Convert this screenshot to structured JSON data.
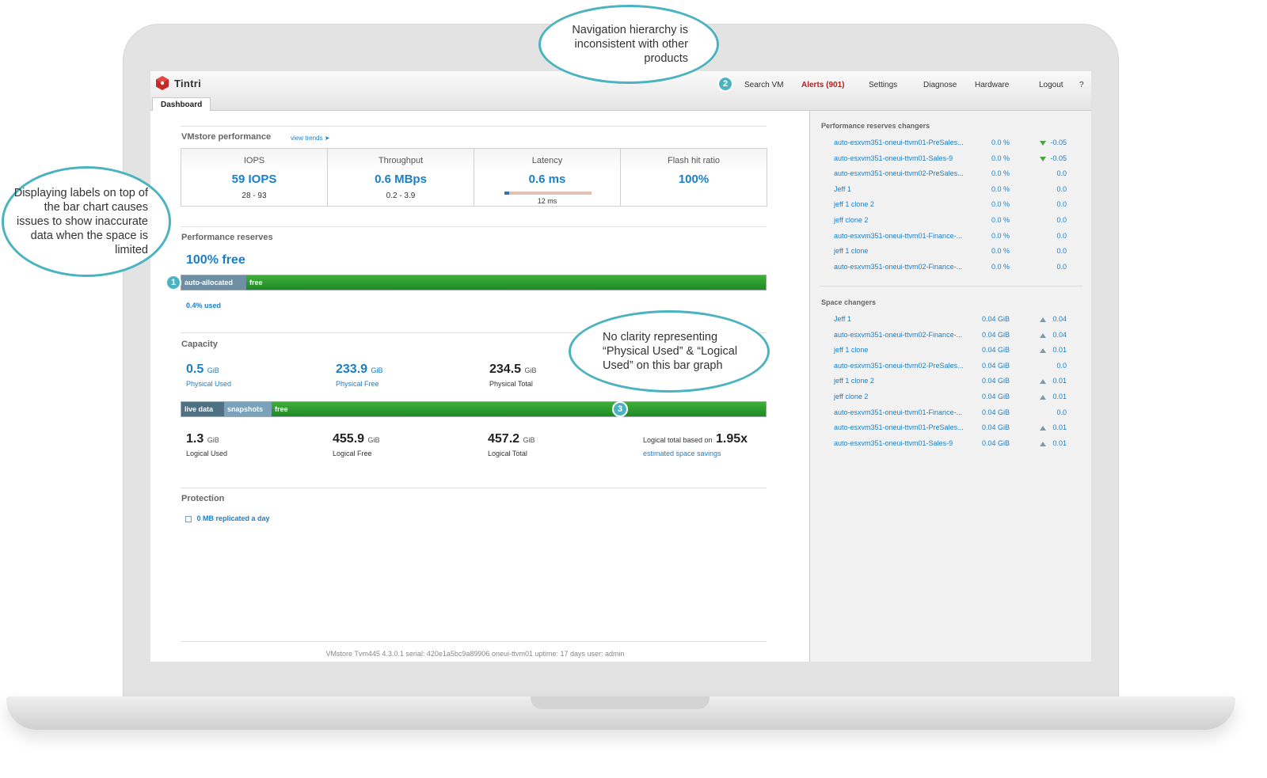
{
  "app": {
    "brand": "Tintri",
    "tab": "Dashboard"
  },
  "nav": {
    "search": "Search VM",
    "alerts": "Alerts (901)",
    "settings": "Settings",
    "diagnose": "Diagnose",
    "hardware": "Hardware",
    "logout": "Logout",
    "help": "?"
  },
  "performance": {
    "title": "VMstore performance",
    "trends_link": "view trends",
    "metrics": [
      {
        "label": "IOPS",
        "value": "59 IOPS",
        "range": "28 - 93"
      },
      {
        "label": "Throughput",
        "value": "0.6 MBps",
        "range": "0.2 - 3.9"
      },
      {
        "label": "Latency",
        "value": "0.6 ms",
        "range": "12 ms"
      },
      {
        "label": "Flash hit ratio",
        "value": "100%",
        "range": ""
      }
    ]
  },
  "reserves": {
    "title": "Performance reserves",
    "free_text": "100% free",
    "seg_auto": "auto-allocated",
    "seg_free": "free",
    "used_text": "0.4% used"
  },
  "capacity": {
    "title": "Capacity",
    "physical_used": {
      "value": "0.5",
      "unit": "GiB",
      "label": "Physical Used"
    },
    "physical_free": {
      "value": "233.9",
      "unit": "GiB",
      "label": "Physical Free"
    },
    "physical_total": {
      "value": "234.5",
      "unit": "GiB",
      "label": "Physical Total"
    },
    "seg_live": "live data",
    "seg_snap": "snapshots",
    "seg_free": "free",
    "logical_used": {
      "value": "1.3",
      "unit": "GiB",
      "label": "Logical Used"
    },
    "logical_free": {
      "value": "455.9",
      "unit": "GiB",
      "label": "Logical Free"
    },
    "logical_total": {
      "value": "457.2",
      "unit": "GiB",
      "label": "Logical Total"
    },
    "savings_prefix": "Logical total based on",
    "savings_value": "1.95x",
    "savings_link": "estimated space savings"
  },
  "protection": {
    "title": "Protection",
    "replicated": "0 MB replicated a day"
  },
  "footer": "VMstore Tvm445 4.3.0.1   serial: 420e1a5bc9a89906   oneui-ttvm01 uptime: 17 days   user: admin",
  "sidebar": {
    "reserves_title": "Performance reserves changers",
    "reserves_rows": [
      {
        "name": "auto-esxvm351-oneui-ttvm01-PreSales...",
        "pct": "0.0 %",
        "delta": "-0.05",
        "dir": "down"
      },
      {
        "name": "auto-esxvm351-oneui-ttvm01-Sales-9",
        "pct": "0.0 %",
        "delta": "-0.05",
        "dir": "down"
      },
      {
        "name": "auto-esxvm351-oneui-ttvm02-PreSales...",
        "pct": "0.0 %",
        "delta": "0.0",
        "dir": "none"
      },
      {
        "name": "Jeff 1",
        "pct": "0.0 %",
        "delta": "0.0",
        "dir": "none"
      },
      {
        "name": "jeff 1 clone 2",
        "pct": "0.0 %",
        "delta": "0.0",
        "dir": "none"
      },
      {
        "name": "jeff clone 2",
        "pct": "0.0 %",
        "delta": "0.0",
        "dir": "none"
      },
      {
        "name": "auto-esxvm351-oneui-ttvm01-Finance-...",
        "pct": "0.0 %",
        "delta": "0.0",
        "dir": "none"
      },
      {
        "name": "jeff 1 clone",
        "pct": "0.0 %",
        "delta": "0.0",
        "dir": "none"
      },
      {
        "name": "auto-esxvm351-oneui-ttvm02-Finance-...",
        "pct": "0.0 %",
        "delta": "0.0",
        "dir": "none"
      }
    ],
    "space_title": "Space changers",
    "space_rows": [
      {
        "name": "Jeff 1",
        "size": "0.04 GiB",
        "delta": "0.04",
        "dir": "up"
      },
      {
        "name": "auto-esxvm351-oneui-ttvm02-Finance-...",
        "size": "0.04 GiB",
        "delta": "0.04",
        "dir": "up"
      },
      {
        "name": "jeff 1 clone",
        "size": "0.04 GiB",
        "delta": "0.01",
        "dir": "up"
      },
      {
        "name": "auto-esxvm351-oneui-ttvm02-PreSales...",
        "size": "0.04 GiB",
        "delta": "0.0",
        "dir": "none"
      },
      {
        "name": "jeff 1 clone 2",
        "size": "0.04 GiB",
        "delta": "0.01",
        "dir": "up"
      },
      {
        "name": "jeff clone 2",
        "size": "0.04 GiB",
        "delta": "0.01",
        "dir": "up"
      },
      {
        "name": "auto-esxvm351-oneui-ttvm01-Finance-...",
        "size": "0.04 GiB",
        "delta": "0.0",
        "dir": "none"
      },
      {
        "name": "auto-esxvm351-oneui-ttvm01-PreSales...",
        "size": "0.04 GiB",
        "delta": "0.01",
        "dir": "up"
      },
      {
        "name": "auto-esxvm351-oneui-ttvm01-Sales-9",
        "size": "0.04 GiB",
        "delta": "0.01",
        "dir": "up"
      }
    ]
  },
  "callouts": {
    "c1": "Displaying labels on top of the bar chart causes issues to show inaccurate data when the space is limited",
    "c2": "Navigation hierarchy is inconsistent with other products",
    "c3": "No clarity representing “Physical Used” & “Logical Used” on this bar graph",
    "b1": "1",
    "b2": "2",
    "b3": "3"
  },
  "colors": {
    "accent": "#1a7fc8",
    "alert": "#b0211d",
    "callout": "#4bb3c0",
    "bar_green": "#2f9e33"
  }
}
